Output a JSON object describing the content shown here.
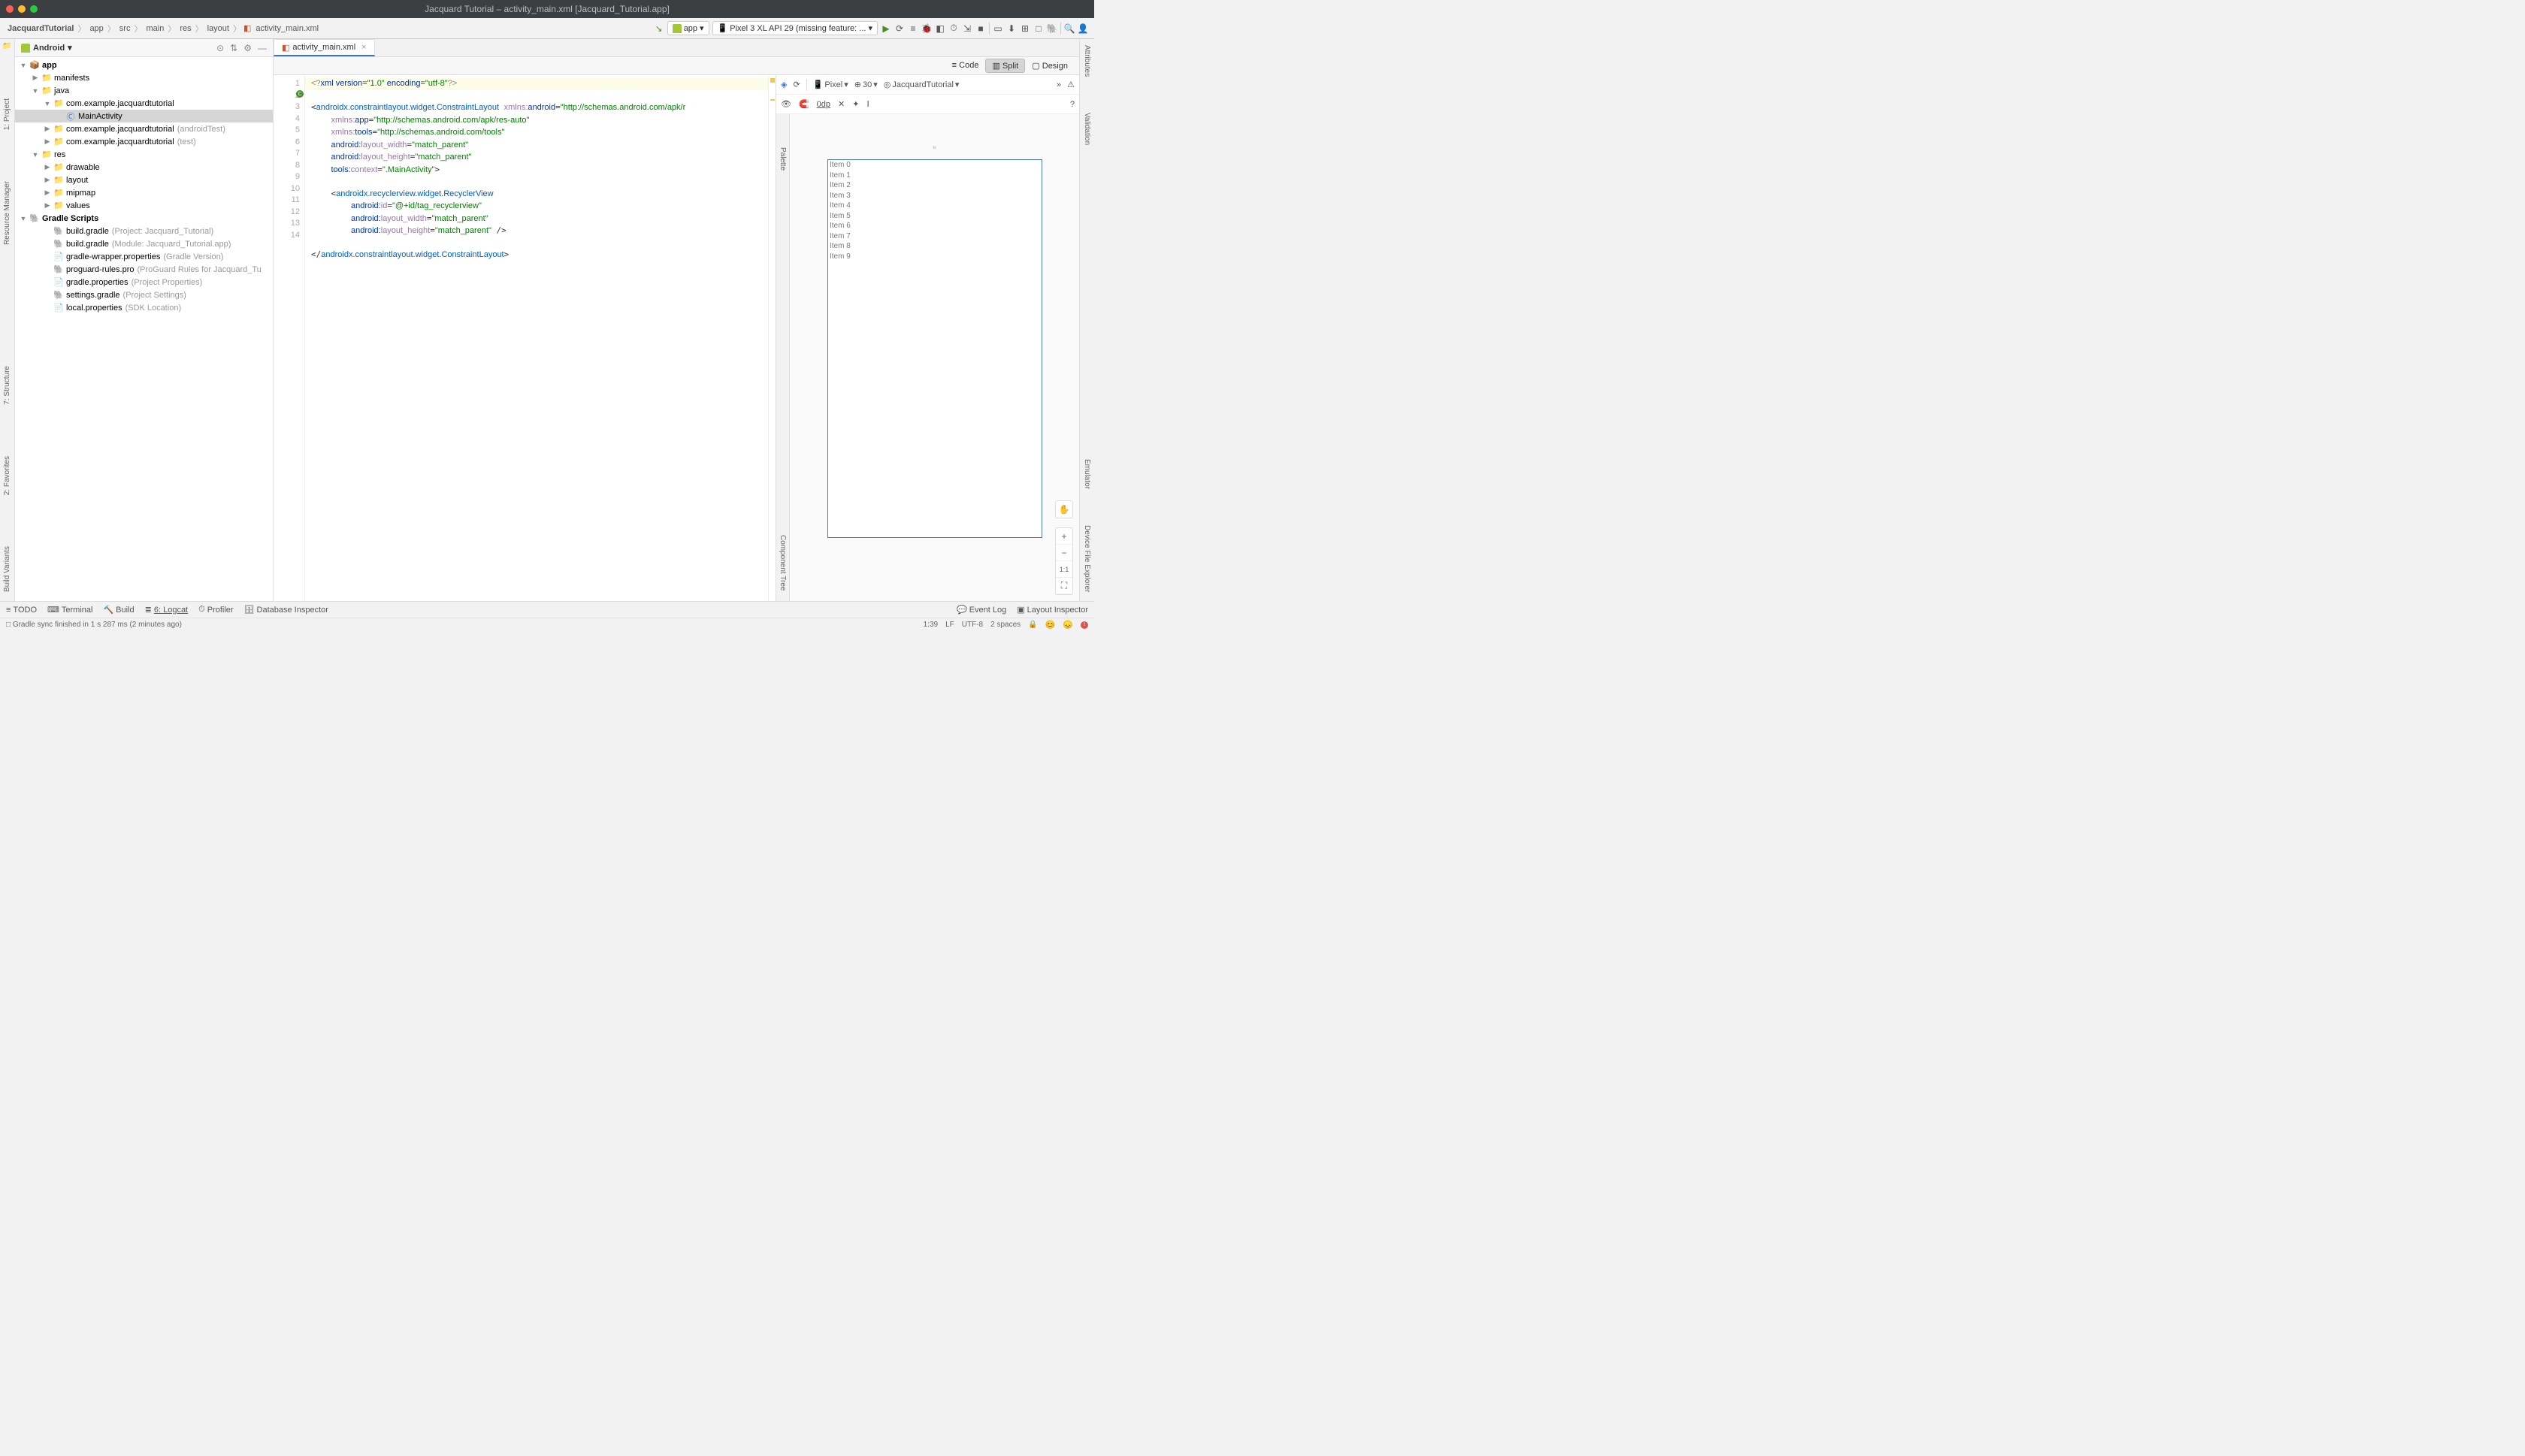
{
  "window": {
    "title": "Jacquard Tutorial – activity_main.xml [Jacquard_Tutorial.app]"
  },
  "breadcrumbs": [
    "JacquardTutorial",
    "app",
    "src",
    "main",
    "res",
    "layout",
    "activity_main.xml"
  ],
  "toolbar": {
    "config": "app",
    "device": "Pixel 3 XL API 29 (missing feature: ..."
  },
  "project": {
    "mode": "Android",
    "tree": {
      "app": "app",
      "manifests": "manifests",
      "java": "java",
      "pkg": "com.example.jacquardtutorial",
      "main_activity": "MainActivity",
      "pkg_at": "com.example.jacquardtutorial",
      "pkg_at_hint": "(androidTest)",
      "pkg_test": "com.example.jacquardtutorial",
      "pkg_test_hint": "(test)",
      "res": "res",
      "drawable": "drawable",
      "layout": "layout",
      "mipmap": "mipmap",
      "values": "values",
      "gradle_scripts": "Gradle Scripts",
      "bg_project": "build.gradle",
      "bg_project_hint": "(Project: Jacquard_Tutorial)",
      "bg_module": "build.gradle",
      "bg_module_hint": "(Module: Jacquard_Tutorial.app)",
      "gw_props": "gradle-wrapper.properties",
      "gw_props_hint": "(Gradle Version)",
      "proguard": "proguard-rules.pro",
      "proguard_hint": "(ProGuard Rules for Jacquard_Tu",
      "gradle_props": "gradle.properties",
      "gradle_props_hint": "(Project Properties)",
      "settings": "settings.gradle",
      "settings_hint": "(Project Settings)",
      "local_props": "local.properties",
      "local_props_hint": "(SDK Location)"
    }
  },
  "tab": {
    "name": "activity_main.xml"
  },
  "code": {
    "lines": [
      "1",
      "2",
      "3",
      "4",
      "5",
      "6",
      "7",
      "8",
      "9",
      "10",
      "11",
      "12",
      "13",
      "14"
    ]
  },
  "design": {
    "modes": {
      "code": "Code",
      "split": "Split",
      "design": "Design"
    },
    "device": "Pixel",
    "api": "30",
    "theme": "JacquardTutorial",
    "dp": "0dp",
    "items": [
      "Item 0",
      "Item 1",
      "Item 2",
      "Item 3",
      "Item 4",
      "Item 5",
      "Item 6",
      "Item 7",
      "Item 8",
      "Item 9"
    ],
    "zoom": "1:1"
  },
  "bottom": {
    "todo": "TODO",
    "terminal": "Terminal",
    "build": "Build",
    "logcat": "6: Logcat",
    "profiler": "Profiler",
    "db": "Database Inspector",
    "event_log": "Event Log",
    "layout_inspector": "Layout Inspector"
  },
  "status": {
    "msg": "Gradle sync finished in 1 s 287 ms (2 minutes ago)",
    "pos": "1:39",
    "le": "LF",
    "enc": "UTF-8",
    "indent": "2 spaces"
  },
  "rails": {
    "project": "1: Project",
    "rm": "Resource Manager",
    "structure": "7: Structure",
    "favorites": "2: Favorites",
    "bv": "Build Variants",
    "attributes": "Attributes",
    "validation": "Validation",
    "emulator": "Emulator",
    "dfe": "Device File Explorer",
    "palette": "Palette",
    "ctree": "Component Tree"
  }
}
